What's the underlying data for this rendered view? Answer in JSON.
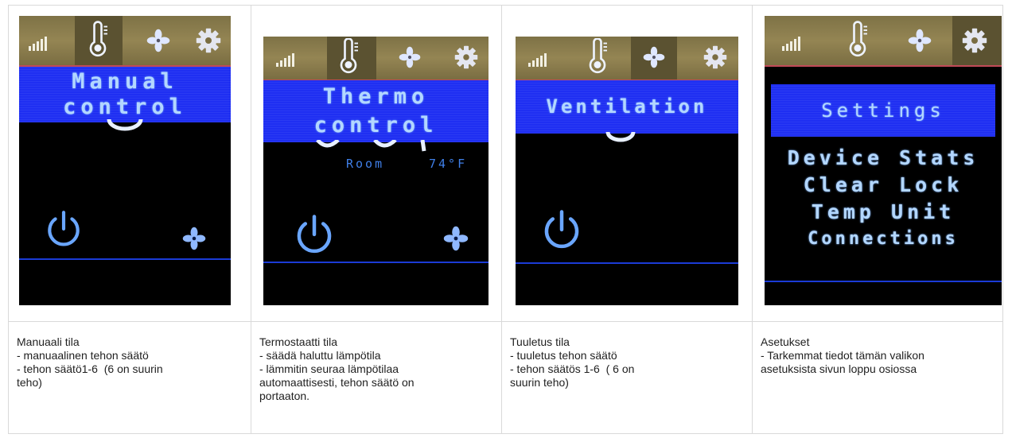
{
  "panels": [
    {
      "screen": {
        "banner_lines": [
          "Manual",
          "control"
        ]
      },
      "caption": [
        "Manuaali tila",
        "- manuaalinen tehon säätö",
        "- tehon säätö1-6  (6 on suurin",
        "teho)"
      ]
    },
    {
      "screen": {
        "banner_lines": [
          "Thermo",
          "control"
        ],
        "room_label": "Room",
        "room_temp": "74°F"
      },
      "caption": [
        "Termostaatti tila",
        "- säädä haluttu lämpötila",
        "- lämmitin seuraa lämpötilaa",
        "automaattisesti, tehon säätö on",
        "portaaton."
      ]
    },
    {
      "screen": {
        "banner_lines": [
          "Ventilation"
        ]
      },
      "caption": [
        "Tuuletus tila",
        "- tuuletus tehon säätö",
        "- tehon säätös 1-6  ( 6 on",
        "suurin teho)"
      ]
    },
    {
      "screen": {
        "banner_lines": [
          "Settings"
        ],
        "menu_items": [
          "Device Stats",
          "Clear Lock",
          "Temp Unit",
          "Connections"
        ]
      },
      "caption": [
        "Asetukset",
        "- Tarkemmat tiedot tämän valikon",
        "asetuksista sivun loppu osiossa"
      ]
    }
  ],
  "icons": [
    "signal-bars-icon",
    "thermometer-icon",
    "fan-icon",
    "gear-icon",
    "power-icon"
  ],
  "colors": {
    "banner": "#1f2ff2",
    "text_glow": "#b3d7ff",
    "topbar": "#948553",
    "screen_bg": "#000000",
    "accent_line": "#1b3bd6"
  }
}
